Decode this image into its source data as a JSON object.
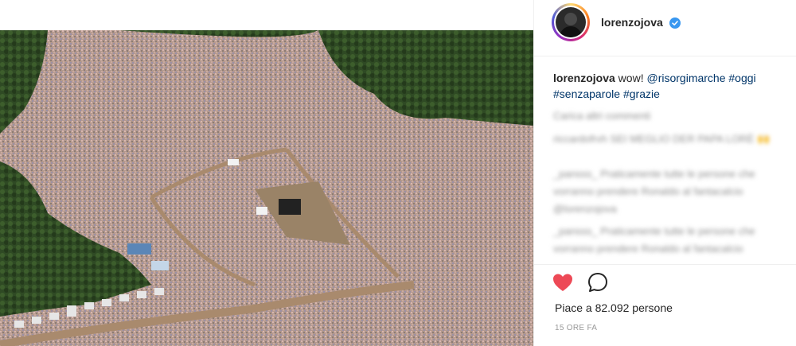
{
  "post": {
    "username": "lorenzojova",
    "caption_user": "lorenzojova",
    "caption_text": " wow! ",
    "caption_mention": "@risorgimarche",
    "caption_tag1": "#oggi",
    "caption_tag2": "#senzaparole",
    "caption_tag3": "#grazie",
    "load_more_comments": "Carica altri commenti",
    "comments": [
      {
        "text": "riccardofrvh SEI MEGLIO DER PAPA LORÈ 🙌"
      },
      {
        "text": "_pansss_ Praticamente tutte le persone che vorranno prendere Ronaldo al fantacalcio"
      },
      {
        "text": "@lorenzojova"
      },
      {
        "text": "_pansss_ Praticamente tutte le persone che vorranno prendere Ronaldo al fantacalcio"
      }
    ],
    "likes_text": "Piace a 82.092 persone",
    "time_text": "15 ORE FA",
    "icons": {
      "heart": "heart-icon",
      "comment": "comment-icon",
      "verified": "verified-badge-icon"
    },
    "colors": {
      "heart": "#ed4956",
      "link": "#003569",
      "verified": "#3897f0"
    }
  }
}
